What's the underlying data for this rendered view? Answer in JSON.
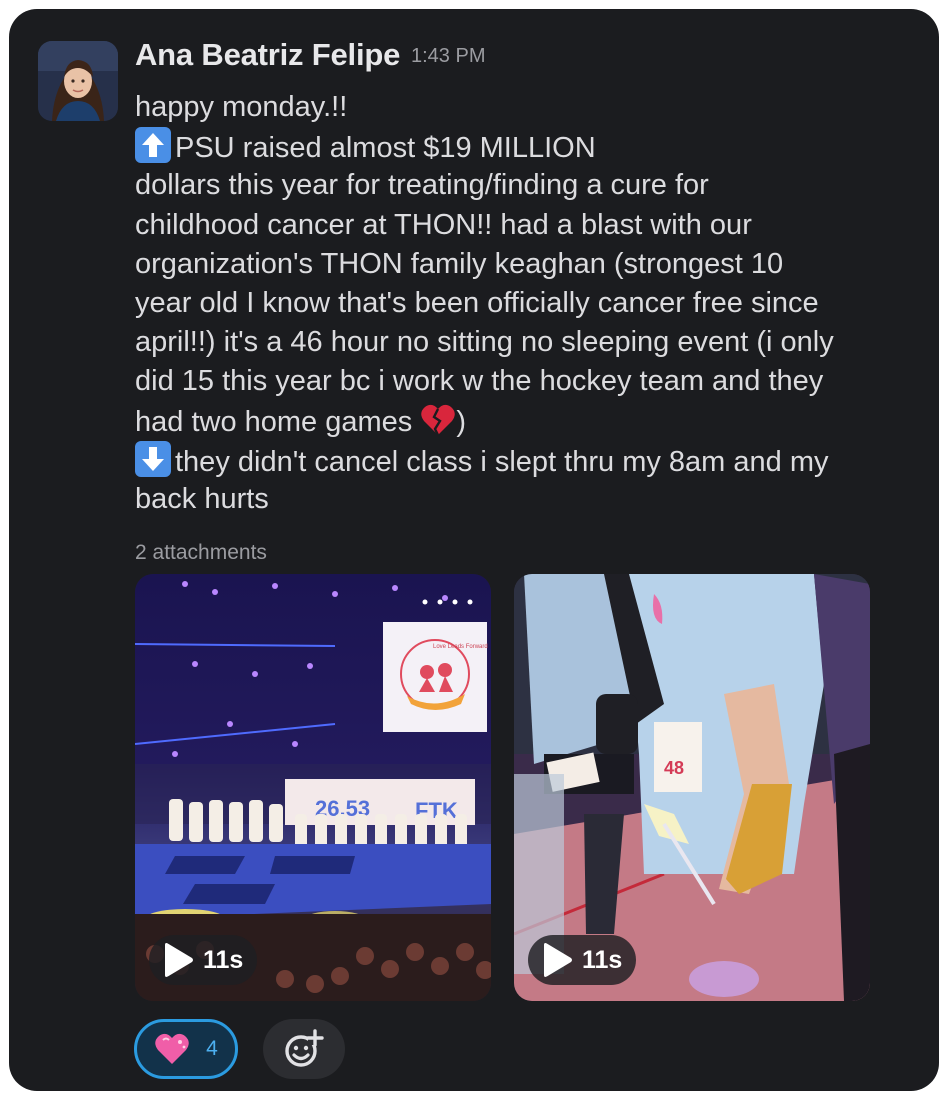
{
  "message": {
    "author": "Ana Beatriz Felipe",
    "time": "1:43 PM",
    "lines": [
      "happy monday.!!",
      "PSU raised almost $19 MILLION",
      "dollars this year for treating/finding a cure for",
      "childhood cancer at THON!! had a blast with our",
      "organization's THON family keaghan (strongest 10",
      "year old I know that's been officially cancer free since",
      "april!!) it's a 46 hour no sitting no sleeping event (i only",
      "did 15 this year bc i work w the hockey team and they",
      "had two home games",
      ")",
      "they didn't cancel class i slept thru my 8am and my",
      "back hurts"
    ],
    "emoji_names": [
      "arrow-up-emoji",
      "broken-heart-emoji",
      "arrow-down-emoji"
    ]
  },
  "attachments": {
    "label": "2 attachments",
    "videos": [
      {
        "duration": "11s",
        "board_text": "26,53",
        "board_letters": "FTK",
        "logo_text": "Love Leads Forward"
      },
      {
        "duration": "11s",
        "bib_text": "48"
      }
    ]
  },
  "reactions": {
    "heart_count": "4",
    "heart_icon": "pink-heart-icon",
    "add_icon": "add-reaction-icon"
  },
  "colors": {
    "card_bg": "#1b1c1f",
    "text": "#dcdcdf",
    "muted": "#9b9ca1",
    "reaction_border": "#2b9be0",
    "emoji_blue": "#4a8fe6",
    "broken_heart": "#d9263c"
  }
}
